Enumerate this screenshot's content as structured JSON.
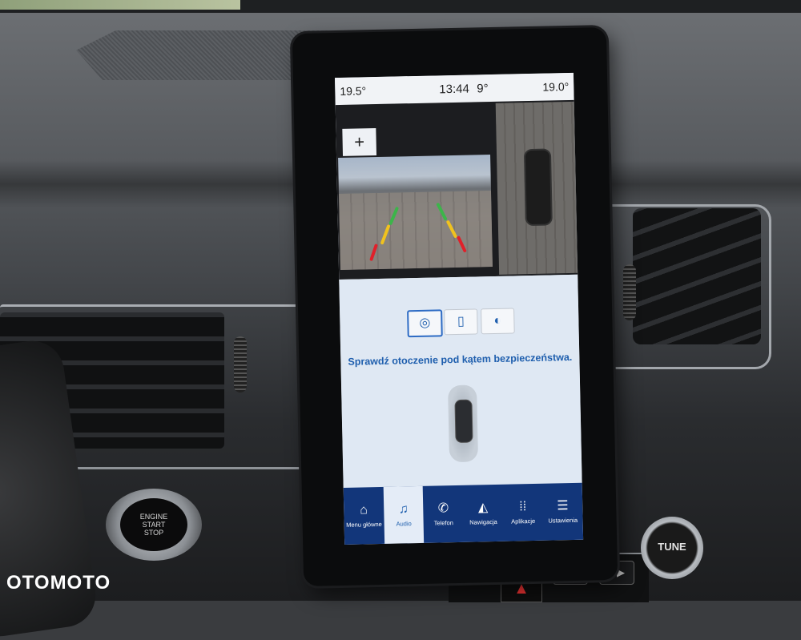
{
  "status_bar": {
    "temp_left": "19.5°",
    "clock": "13:44",
    "outside_temp": "9°",
    "temp_right": "19.0°"
  },
  "camera": {
    "zoom_label": "+"
  },
  "view_buttons": [
    {
      "icon": "camera-rear-icon",
      "glyph": "◎",
      "active": true
    },
    {
      "icon": "car-top-icon",
      "glyph": "▯",
      "active": false
    },
    {
      "icon": "camera-split-icon",
      "glyph": "◐",
      "active": false
    }
  ],
  "safety_message": "Sprawdź otoczenie pod kątem bezpieczeństwa.",
  "nav": [
    {
      "label": "Menu główne",
      "icon": "home-icon",
      "glyph": "⌂"
    },
    {
      "label": "Audio",
      "icon": "music-icon",
      "glyph": "♫",
      "active": true
    },
    {
      "label": "Telefon",
      "icon": "phone-icon",
      "glyph": "✆"
    },
    {
      "label": "Nawigacja",
      "icon": "navigation-icon",
      "glyph": "◭"
    },
    {
      "label": "Aplikacje",
      "icon": "apps-icon",
      "glyph": "⁞⁞"
    },
    {
      "label": "Ustawienia",
      "icon": "settings-icon",
      "glyph": "☰"
    }
  ],
  "hardware": {
    "engine_button": [
      "ENGINE",
      "START",
      "STOP"
    ],
    "tune_label": "TUNE"
  },
  "watermark": "OTOMOTO"
}
